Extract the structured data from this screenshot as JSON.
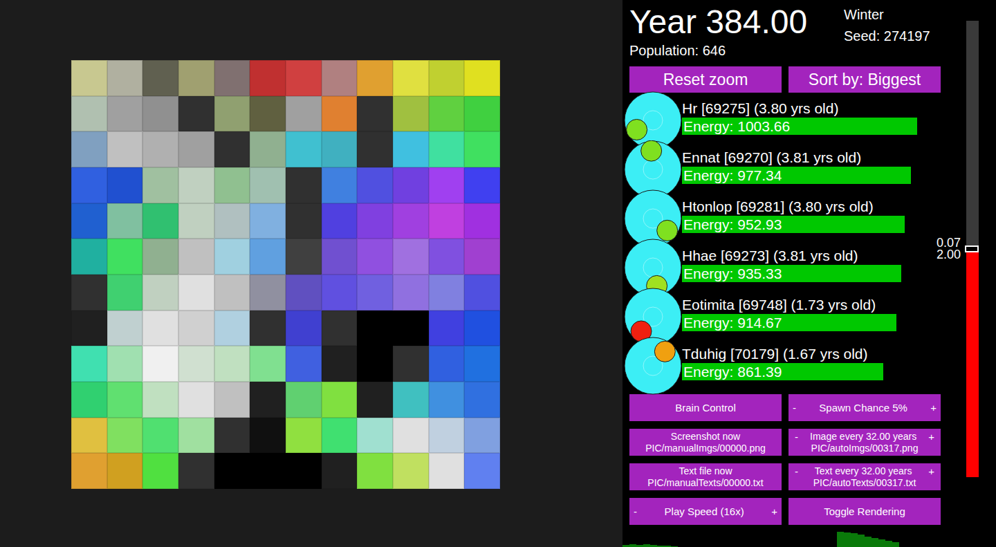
{
  "header": {
    "year": "Year 384.00",
    "season": "Winter",
    "seed": "Seed: 274197",
    "population": "Population: 646"
  },
  "top_buttons": [
    "Reset zoom",
    "Sort by: Biggest"
  ],
  "creatures": [
    {
      "name": "Hr [69275] (3.80 yrs old)",
      "energy": "Energy: 1003.66",
      "level": 0.97,
      "color": "#7fe020",
      "heading": 150
    },
    {
      "name": "Ennat [69270] (3.81 yrs old)",
      "energy": "Energy: 977.34",
      "level": 0.945,
      "color": "#7fe020",
      "heading": 265
    },
    {
      "name": "Htonlop [69281] (3.80 yrs old)",
      "energy": "Energy: 952.93",
      "level": 0.92,
      "color": "#7fe020",
      "heading": 40
    },
    {
      "name": "Hhae [69273] (3.81 yrs old)",
      "energy": "Energy: 935.33",
      "level": 0.905,
      "color": "#a0e020",
      "heading": 78
    },
    {
      "name": "Eotimita [69748] (1.73 yrs old)",
      "energy": "Energy: 914.67",
      "level": 0.885,
      "color": "#f02010",
      "heading": 129
    },
    {
      "name": "Tduhig [70179] (1.67 yrs old)",
      "energy": "Energy: 861.39",
      "level": 0.83,
      "color": "#f0a010",
      "heading": 310
    }
  ],
  "controls": [
    {
      "kind": "single",
      "label": "Brain Control"
    },
    {
      "kind": "stepper",
      "minus": "-",
      "label": "Spawn Chance 5%",
      "plus": "+"
    },
    {
      "kind": "double",
      "label": "Screenshot now",
      "sub": "PIC/manualImgs/00000.png"
    },
    {
      "kind": "stepper2",
      "minus": "-",
      "label": "Image every 32.00 years",
      "plus": "+",
      "sub": "PIC/autoImgs/00317.png"
    },
    {
      "kind": "double",
      "label": "Text file now",
      "sub": "PIC/manualTexts/00000.txt"
    },
    {
      "kind": "stepper2",
      "minus": "-",
      "label": "Text every 32.00 years",
      "plus": "+",
      "sub": "PIC/autoTexts/00317.txt"
    },
    {
      "kind": "stepper",
      "minus": "-",
      "label": "Play Speed (16x)",
      "plus": "+"
    },
    {
      "kind": "single",
      "label": "Toggle Rendering"
    }
  ],
  "slider": {
    "level": 0.5,
    "labels": [
      "0.07",
      "2.00"
    ]
  },
  "history": {
    "values": [
      3,
      4,
      3,
      4,
      3,
      2,
      2,
      1,
      0,
      0,
      0,
      0,
      0,
      0,
      0,
      0,
      0,
      0,
      0,
      0,
      0,
      0,
      0,
      0,
      0,
      0,
      0,
      0,
      0,
      0,
      0,
      20,
      19,
      18,
      16,
      14,
      12,
      10,
      8,
      6,
      0,
      0,
      0,
      0,
      0,
      0,
      0,
      0,
      0,
      0,
      0,
      0,
      0,
      0
    ]
  },
  "map": {
    "tiles": [
      [
        "#c8c890",
        "#b0b0a0",
        "#606050",
        "#a0a070",
        "#807070",
        "#c03030",
        "#d04040",
        "#b08080",
        "#e0a030",
        "#e0e040",
        "#c0d030",
        "#e0e020"
      ],
      [
        "#b0c0b0",
        "#a0a0a0",
        "#909090",
        "#303030",
        "#90a070",
        "#606040",
        "#a0a0a0",
        "#e08030",
        "#303030",
        "#a0c040",
        "#60d040",
        "#40d040"
      ],
      [
        "#80a0c0",
        "#c0c0c0",
        "#b0b0b0",
        "#a0a0a0",
        "#303030",
        "#90b090",
        "#40c0d0",
        "#40b0c0",
        "#303030",
        "#40c0e0",
        "#40e0a0",
        "#40e060"
      ],
      [
        "#3060e0",
        "#2050d0",
        "#a0c0a0",
        "#c0d0c0",
        "#90c090",
        "#a0c0b0",
        "#303030",
        "#4080e0",
        "#5050e0",
        "#7040e0",
        "#a040f0",
        "#4040f0"
      ],
      [
        "#2060d0",
        "#80c0a0",
        "#30c070",
        "#c0d0c0",
        "#b0c0c0",
        "#80b0e0",
        "#303030",
        "#5040e0",
        "#8040e0",
        "#a040e0",
        "#c040e0",
        "#a030e0"
      ],
      [
        "#20b0a0",
        "#40e060",
        "#90b090",
        "#c0c0c0",
        "#a0d0e0",
        "#60a0e0",
        "#404040",
        "#7050d0",
        "#9050e0",
        "#a070e0",
        "#8050e0",
        "#a040d0"
      ],
      [
        "#303030",
        "#40d070",
        "#c0d0c0",
        "#e0e0e0",
        "#c0c0c0",
        "#9090a0",
        "#6050c0",
        "#6050e0",
        "#7060e0",
        "#9070e0",
        "#8080e0",
        "#5050e0"
      ],
      [
        "#202020",
        "#c0d0d0",
        "#e0e0e0",
        "#d0d0d0",
        "#b0d0e0",
        "#303030",
        "#4040d0",
        "#303030",
        "#000000",
        "#000000",
        "#4040e0",
        "#2050e0"
      ],
      [
        "#40e0b0",
        "#a0e0b0",
        "#f0f0f0",
        "#d0e0d0",
        "#c0e0c0",
        "#80e090",
        "#4060e0",
        "#202020",
        "#000000",
        "#303030",
        "#3060e0",
        "#2070e0"
      ],
      [
        "#30d070",
        "#60e070",
        "#c0e0c0",
        "#e0e0e0",
        "#c0c0c0",
        "#202020",
        "#60d070",
        "#80e040",
        "#202020",
        "#40c0c0",
        "#4090e0",
        "#3070e0"
      ],
      [
        "#e0c040",
        "#80e060",
        "#50e070",
        "#a0e0a0",
        "#303030",
        "#101010",
        "#90e040",
        "#40e070",
        "#a0e0d0",
        "#e0e0e0",
        "#c0d0e0",
        "#80a0e0"
      ],
      [
        "#e0a030",
        "#d0a020",
        "#50e040",
        "#303030",
        "#000000",
        "#000000",
        "#000000",
        "#202020",
        "#80e040",
        "#c0e060",
        "#e0e0e0",
        "#6080f0"
      ]
    ]
  }
}
